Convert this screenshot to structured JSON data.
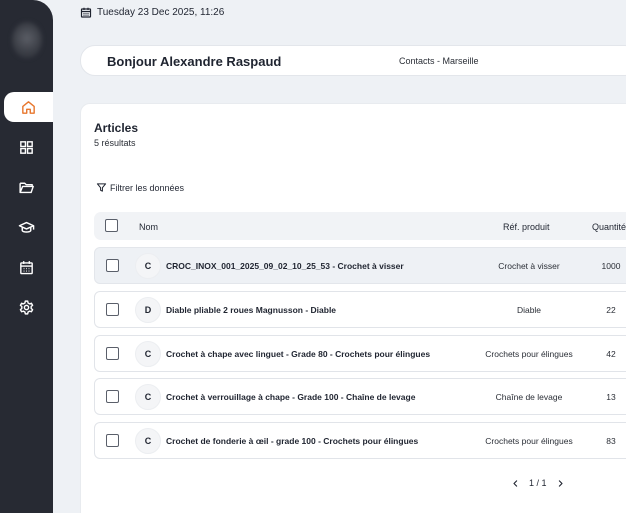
{
  "header": {
    "date": "Tuesday 23 Dec 2025, 11:26"
  },
  "greeting": {
    "title": "Bonjour Alexandre Raspaud",
    "context": "Contacts - Marseille"
  },
  "sidebar": {
    "items": [
      {
        "icon": "home-icon",
        "active": true
      },
      {
        "icon": "grid-icon"
      },
      {
        "icon": "folder-icon"
      },
      {
        "icon": "school-icon"
      },
      {
        "icon": "calendar-icon"
      },
      {
        "icon": "gear-icon"
      }
    ],
    "accent": "#e8772e",
    "bg": "#272a33"
  },
  "articles": {
    "title": "Articles",
    "count": "5 résultats",
    "filter_label": "Filtrer les données",
    "columns": [
      "Nom",
      "Réf. produit",
      "Quantité"
    ],
    "rows": [
      {
        "initial": "C",
        "name": "CROC_INOX_001_2025_09_02_10_25_53 - Crochet à visser",
        "ref": "Crochet à visser",
        "qty": "1000"
      },
      {
        "initial": "D",
        "name": "Diable pliable 2 roues Magnusson - Diable",
        "ref": "Diable",
        "qty": "22"
      },
      {
        "initial": "C",
        "name": "Crochet à chape avec linguet - Grade 80 - Crochets pour élingues",
        "ref": "Crochets pour élingues",
        "qty": "42"
      },
      {
        "initial": "C",
        "name": "Crochet à verrouillage à chape - Grade 100 - Chaîne de levage",
        "ref": "Chaîne de levage",
        "qty": "13"
      },
      {
        "initial": "C",
        "name": "Crochet de fonderie à œil - grade 100 - Crochets pour élingues",
        "ref": "Crochets pour élingues",
        "qty": "83"
      }
    ],
    "pagination": "1 / 1"
  }
}
